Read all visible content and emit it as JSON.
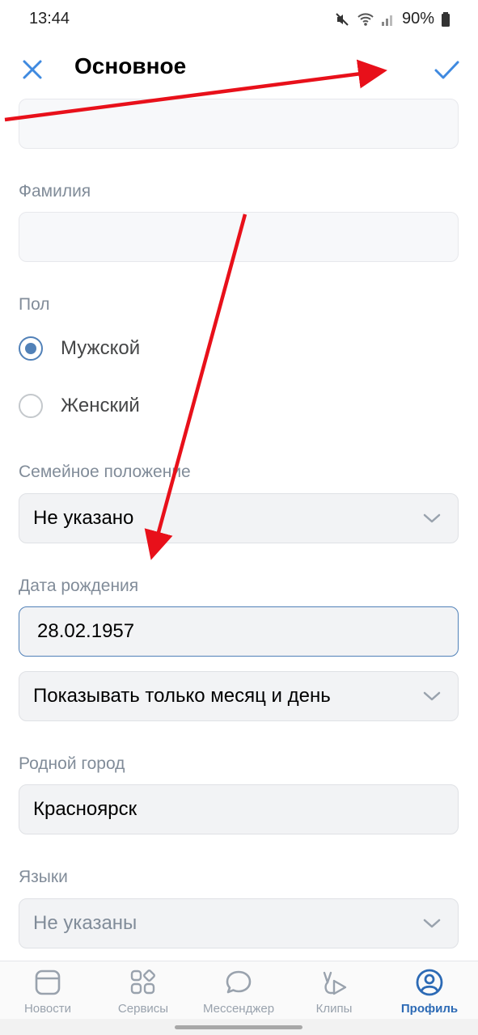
{
  "status": {
    "time": "13:44",
    "battery": "90%"
  },
  "header": {
    "title": "Основное"
  },
  "fields": {
    "first_name": {
      "value": ""
    },
    "last_name": {
      "label": "Фамилия",
      "value": ""
    },
    "gender": {
      "label": "Пол",
      "options": [
        "Мужской",
        "Женский"
      ],
      "selected": "Мужской"
    },
    "marital": {
      "label": "Семейное положение",
      "value": "Не указано"
    },
    "birthdate": {
      "label": "Дата рождения",
      "value": "28.02.1957",
      "visibility": "Показывать только месяц и день"
    },
    "hometown": {
      "label": "Родной город",
      "value": "Красноярск"
    },
    "languages": {
      "label": "Языки",
      "value": "Не указаны"
    }
  },
  "tabs": [
    {
      "label": "Новости",
      "icon": "news-icon"
    },
    {
      "label": "Сервисы",
      "icon": "services-icon"
    },
    {
      "label": "Мессенджер",
      "icon": "messenger-icon"
    },
    {
      "label": "Клипы",
      "icon": "clips-icon"
    },
    {
      "label": "Профиль",
      "icon": "profile-icon",
      "active": true
    }
  ],
  "colors": {
    "accent": "#5181b8",
    "annotation_arrow": "#e8101a",
    "label": "#818c99"
  }
}
